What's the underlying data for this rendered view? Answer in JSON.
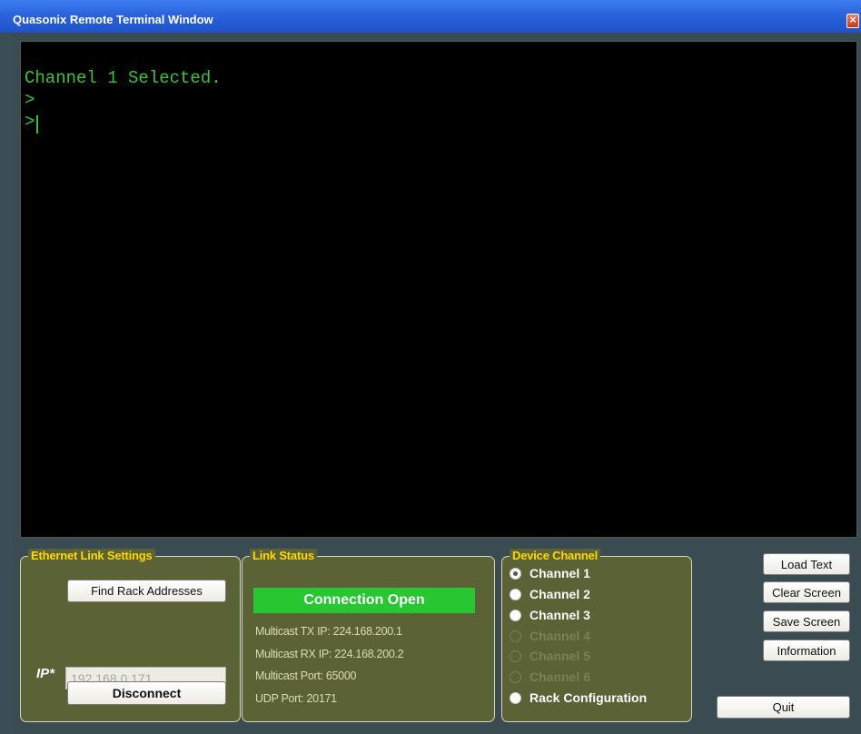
{
  "window": {
    "title": "Quasonix Remote Terminal Window",
    "close_glyph": "×"
  },
  "terminal": {
    "lines": [
      "Channel 1 Selected.",
      ">",
      ">"
    ]
  },
  "ethernet": {
    "legend": "Ethernet Link Settings",
    "find_button": "Find Rack Addresses",
    "ip_label": "IP*",
    "ip_value": "192.168.0.171",
    "disconnect_button": "Disconnect"
  },
  "link_status": {
    "legend": "Link Status",
    "status": "Connection Open",
    "status_color": "#27c732",
    "tx_ip": "Multicast TX IP: 224.168.200.1",
    "rx_ip": "Multicast RX IP: 224.168.200.2",
    "multicast_port": "Multicast Port: 65000",
    "udp_port": "UDP Port: 20171"
  },
  "device_channel": {
    "legend": "Device Channel",
    "options": [
      {
        "label": "Channel 1",
        "enabled": true,
        "checked": true
      },
      {
        "label": "Channel 2",
        "enabled": true,
        "checked": false
      },
      {
        "label": "Channel 3",
        "enabled": true,
        "checked": false
      },
      {
        "label": "Channel 4",
        "enabled": false,
        "checked": false
      },
      {
        "label": "Channel 5",
        "enabled": false,
        "checked": false
      },
      {
        "label": "Channel 6",
        "enabled": false,
        "checked": false
      },
      {
        "label": "Rack Configuration",
        "enabled": true,
        "checked": false
      }
    ]
  },
  "actions": {
    "load_text": "Load Text",
    "clear_screen": "Clear Screen",
    "save_screen": "Save Screen",
    "information": "Information",
    "quit": "Quit"
  }
}
